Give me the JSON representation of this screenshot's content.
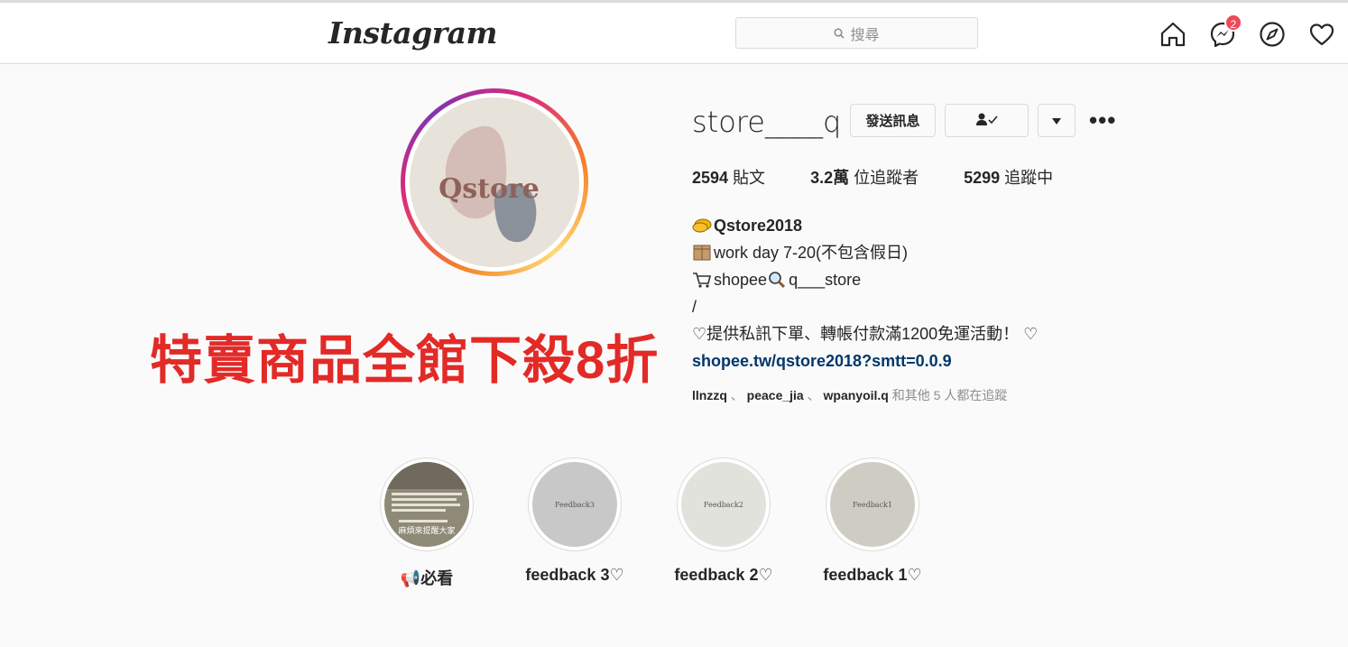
{
  "header": {
    "logo": "Instagram",
    "search_placeholder": "搜尋",
    "messages_badge": "2"
  },
  "profile": {
    "username": "store____q",
    "message_button": "發送訊息",
    "stats": [
      {
        "count": "2594",
        "label": "貼文"
      },
      {
        "count": "3.2萬",
        "label": "位追蹤者"
      },
      {
        "count": "5299",
        "label": "追蹤中"
      }
    ],
    "bio": {
      "name": "Qstore2018",
      "line1": "work day 7-20(不包含假日)",
      "line2_a": "shopee",
      "line2_b": "q___store",
      "line3": "/",
      "line4": "♡提供私訊下單、轉帳付款滿1200免運活動！ ♡",
      "link": "shopee.tw/qstore2018?smtt=0.0.9"
    },
    "followed_by": {
      "users": [
        "llnzzq",
        "peace_jia",
        "wpanyoil.q"
      ],
      "separator": "、",
      "suffix": "和其他 5 人都在追蹤"
    },
    "avatar_text": "Qstore"
  },
  "promo_text": "特賣商品全館下殺8折",
  "highlights": [
    {
      "label": "📢必看",
      "cover_text": "",
      "cover_bottom": "麻煩來提醒大家"
    },
    {
      "label": "feedback 3♡",
      "cover_text": "Feedback3"
    },
    {
      "label": "feedback 2♡",
      "cover_text": "Feedback2"
    },
    {
      "label": "feedback 1♡",
      "cover_text": "Feedback1"
    }
  ],
  "colors": {
    "promo": "#e22a27",
    "link": "#00376b",
    "badge": "#ed4956"
  }
}
